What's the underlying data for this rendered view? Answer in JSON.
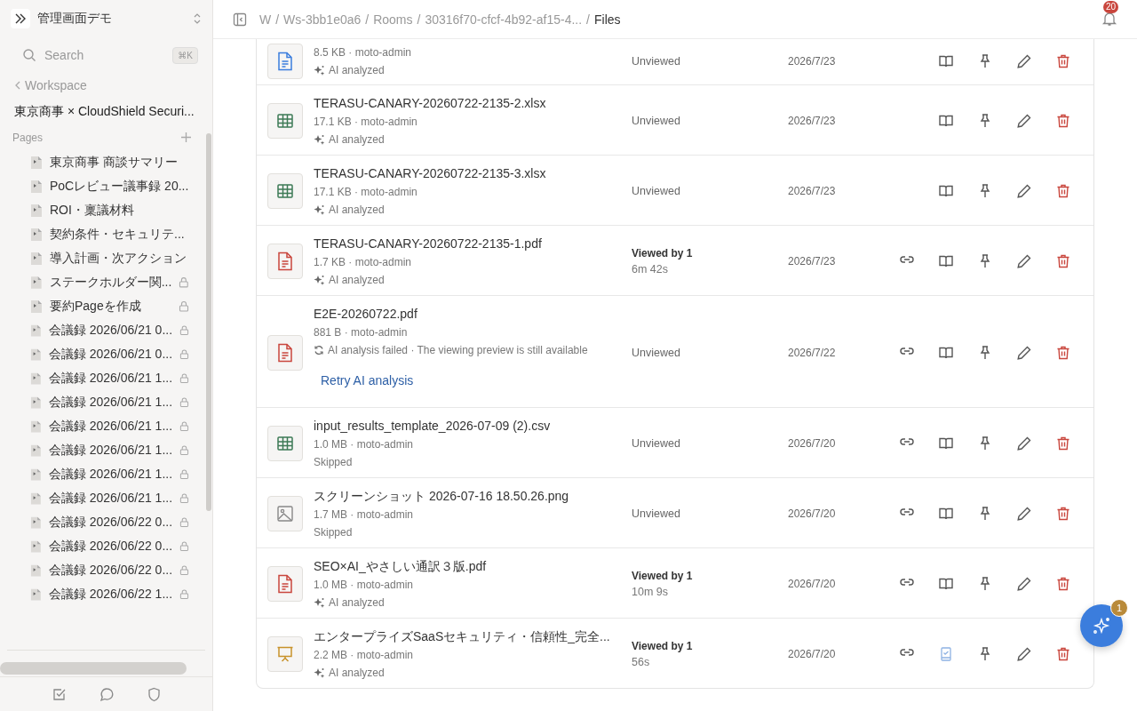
{
  "sidebar": {
    "app_name": "管理画面デモ",
    "search": {
      "placeholder": "Search",
      "shortcut": "⌘K"
    },
    "back_link": "Workspace",
    "workspace_title": "東京商事 × CloudShield Securi...",
    "pages_label": "Pages",
    "pages": [
      {
        "label": "東京商事 商談サマリー",
        "locked": false
      },
      {
        "label": "PoCレビュー議事録 20...",
        "locked": false
      },
      {
        "label": "ROI・稟議材料",
        "locked": false
      },
      {
        "label": "契約条件・セキュリテ...",
        "locked": false
      },
      {
        "label": "導入計画・次アクション",
        "locked": false
      },
      {
        "label": "ステークホルダー関...",
        "locked": true
      },
      {
        "label": "要約Pageを作成",
        "locked": true
      },
      {
        "label": "会議録 2026/06/21 0...",
        "locked": true
      },
      {
        "label": "会議録 2026/06/21 0...",
        "locked": true
      },
      {
        "label": "会議録 2026/06/21 1...",
        "locked": true
      },
      {
        "label": "会議録 2026/06/21 1...",
        "locked": true
      },
      {
        "label": "会議録 2026/06/21 1...",
        "locked": true
      },
      {
        "label": "会議録 2026/06/21 1...",
        "locked": true
      },
      {
        "label": "会議録 2026/06/21 1...",
        "locked": true
      },
      {
        "label": "会議録 2026/06/21 1...",
        "locked": true
      },
      {
        "label": "会議録 2026/06/22 0...",
        "locked": true
      },
      {
        "label": "会議録 2026/06/22 0...",
        "locked": true
      },
      {
        "label": "会議録 2026/06/22 0...",
        "locked": true
      },
      {
        "label": "会議録 2026/06/22 1...",
        "locked": true
      }
    ]
  },
  "header": {
    "breadcrumb": [
      {
        "label": "W",
        "current": false
      },
      {
        "separator": "/",
        "label": "Ws-3bb1e0a6",
        "current": false
      },
      {
        "separator": "/",
        "label": "Rooms",
        "current": false
      },
      {
        "separator": "/",
        "label": "30316f70-cfcf-4b92-af15-4...",
        "current": false
      },
      {
        "separator": "/",
        "label": "Files",
        "current": true
      }
    ],
    "notification_count": "20"
  },
  "files": [
    {
      "kind": "doc",
      "meta": "8.5 KB · moto-admin",
      "analysis": {
        "kind": "analyzed",
        "text": "AI analyzed"
      },
      "status": {
        "kind": "unviewed",
        "text": "Unviewed"
      },
      "date": "2026/7/23",
      "link": false,
      "read": false
    },
    {
      "kind": "sheet",
      "name": "TERASU-CANARY-20260722-2135-2.xlsx",
      "meta": "17.1 KB · moto-admin",
      "analysis": {
        "kind": "analyzed",
        "text": "AI analyzed"
      },
      "status": {
        "kind": "unviewed",
        "text": "Unviewed"
      },
      "date": "2026/7/23",
      "link": false,
      "read": false
    },
    {
      "kind": "sheet",
      "name": "TERASU-CANARY-20260722-2135-3.xlsx",
      "meta": "17.1 KB · moto-admin",
      "analysis": {
        "kind": "analyzed",
        "text": "AI analyzed"
      },
      "status": {
        "kind": "unviewed",
        "text": "Unviewed"
      },
      "date": "2026/7/23",
      "link": false,
      "read": false
    },
    {
      "kind": "pdf",
      "name": "TERASU-CANARY-20260722-2135-1.pdf",
      "meta": "1.7 KB · moto-admin",
      "analysis": {
        "kind": "analyzed",
        "text": "AI analyzed"
      },
      "status": {
        "kind": "viewed",
        "text": "Viewed by 1",
        "duration": "6m 42s"
      },
      "date": "2026/7/23",
      "link": true,
      "read": false
    },
    {
      "kind": "pdf",
      "name": "E2E-20260722.pdf",
      "meta": "881 B · moto-admin",
      "analysis": {
        "kind": "failed",
        "text": "AI analysis failed · The viewing preview is still available",
        "retry": "Retry AI analysis"
      },
      "status": {
        "kind": "unviewed",
        "text": "Unviewed"
      },
      "date": "2026/7/22",
      "link": true,
      "read": false
    },
    {
      "kind": "sheet",
      "name": "input_results_template_2026-07-09 (2).csv",
      "meta": "1.0 MB · moto-admin",
      "analysis": {
        "kind": "skipped",
        "text": "Skipped"
      },
      "status": {
        "kind": "unviewed",
        "text": "Unviewed"
      },
      "date": "2026/7/20",
      "link": true,
      "read": false
    },
    {
      "kind": "image",
      "name": "スクリーンショット 2026-07-16 18.50.26.png",
      "meta": "1.7 MB · moto-admin",
      "analysis": {
        "kind": "skipped",
        "text": "Skipped"
      },
      "status": {
        "kind": "unviewed",
        "text": "Unviewed"
      },
      "date": "2026/7/20",
      "link": true,
      "read": false
    },
    {
      "kind": "pdf",
      "name": "SEO×AI_やさしい通訳３版.pdf",
      "meta": "1.0 MB · moto-admin",
      "analysis": {
        "kind": "analyzed",
        "text": "AI analyzed"
      },
      "status": {
        "kind": "viewed",
        "text": "Viewed by 1",
        "duration": "10m 9s"
      },
      "date": "2026/7/20",
      "link": true,
      "read": false
    },
    {
      "kind": "slides",
      "name": "エンタープライズSaaSセキュリティ・信頼性_完全...",
      "meta": "2.2 MB · moto-admin",
      "analysis": {
        "kind": "analyzed",
        "text": "AI analyzed"
      },
      "status": {
        "kind": "viewed",
        "text": "Viewed by 1",
        "duration": "56s"
      },
      "date": "2026/7/20",
      "link": true,
      "read": true
    }
  ],
  "assistant_button": {
    "badge": "1"
  }
}
